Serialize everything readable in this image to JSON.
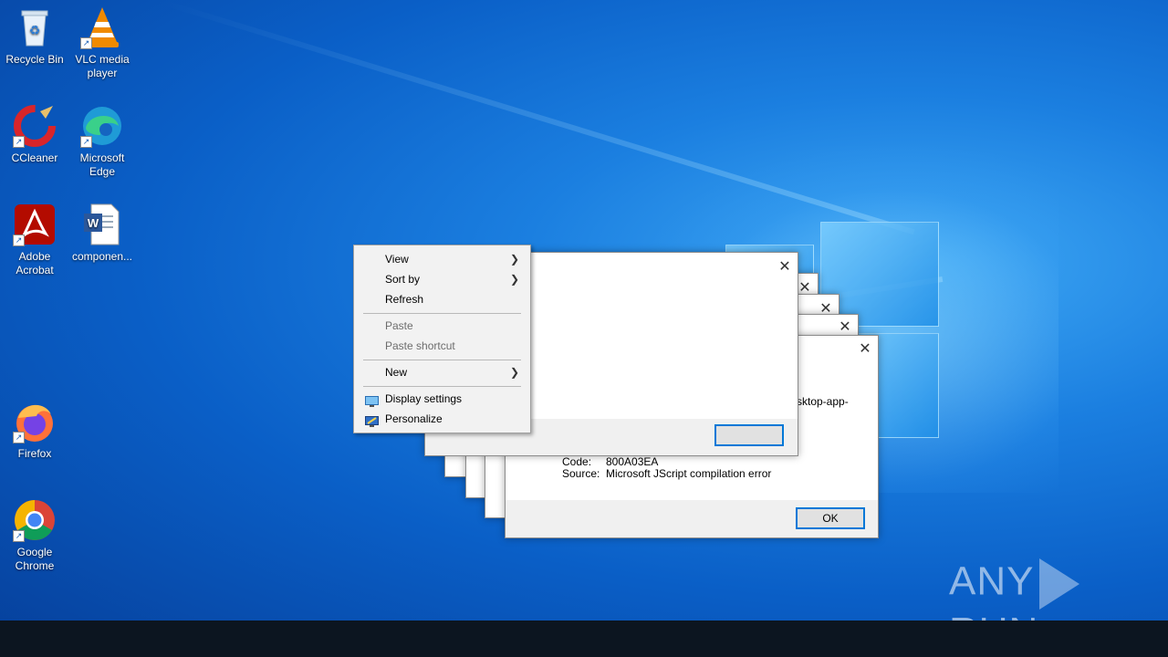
{
  "desktop": {
    "icons": [
      {
        "label": "Recycle Bin",
        "icon": "recycle-bin-icon"
      },
      {
        "label": "VLC media player",
        "icon": "vlc-icon"
      },
      {
        "label": "CCleaner",
        "icon": "ccleaner-icon"
      },
      {
        "label": "Microsoft Edge",
        "icon": "edge-icon"
      },
      {
        "label": "Adobe Acrobat",
        "icon": "acrobat-icon"
      },
      {
        "label": "componen...",
        "icon": "word-document-icon"
      },
      {
        "label": "Firefox",
        "icon": "firefox-icon"
      },
      {
        "label": "Google Chrome",
        "icon": "chrome-icon"
      }
    ]
  },
  "error_dialog": {
    "partial_message": "sktop-app-",
    "code_label": "Code:",
    "code_value": "800A03EA",
    "source_label": "Source:",
    "source_value": "Microsoft JScript compilation error",
    "ok_label": "OK"
  },
  "context_menu": {
    "view": "View",
    "sort_by": "Sort by",
    "refresh": "Refresh",
    "paste": "Paste",
    "paste_shortcut": "Paste shortcut",
    "new": "New",
    "display_settings": "Display settings",
    "personalize": "Personalize"
  },
  "watermark": {
    "left": "ANY",
    "right": "RUN"
  },
  "colors": {
    "desktop_blue": "#0a6fd6",
    "taskbar": "#0c1520",
    "accent": "#0078d7"
  }
}
